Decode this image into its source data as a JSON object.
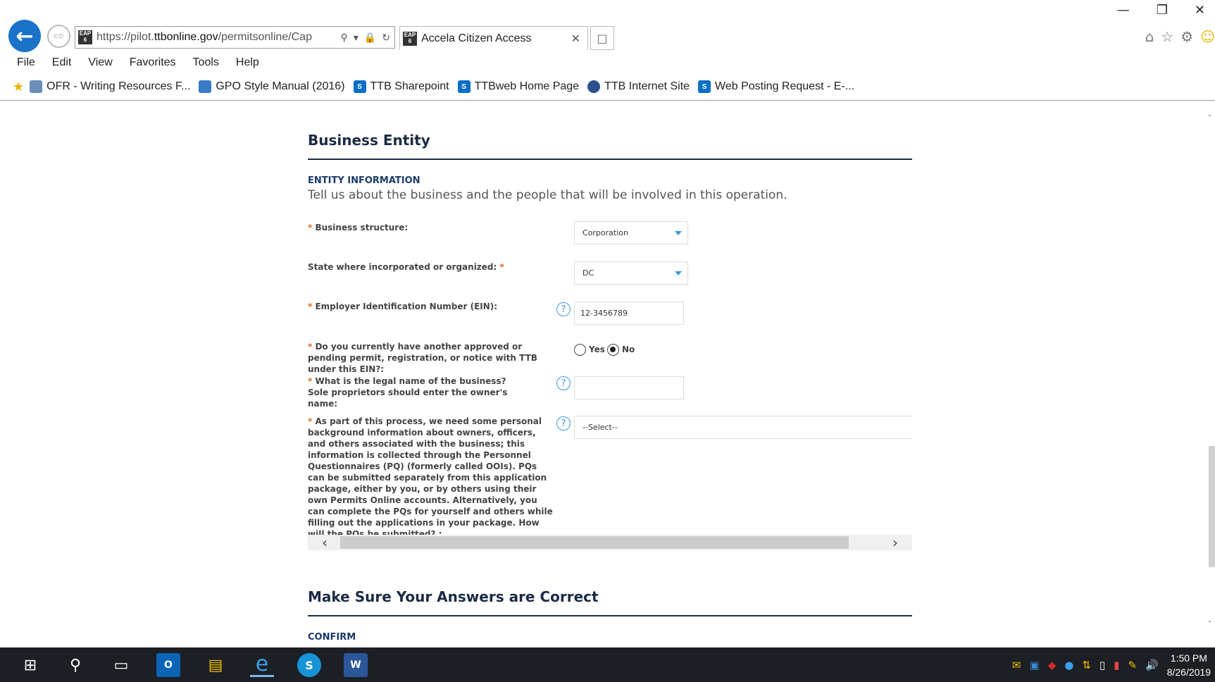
{
  "browser": {
    "url_prefix": "https://pilot.",
    "url_domain": "ttbonline.gov",
    "url_path": "/permitsonline/Cap",
    "favicon_text": "EAP 6",
    "tab_title": "Accela Citizen Access",
    "menu": [
      "File",
      "Edit",
      "View",
      "Favorites",
      "Tools",
      "Help"
    ],
    "favorites": [
      {
        "label": "OFR - Writing Resources F...",
        "icon": "page-icon",
        "color": "#6b8fb8"
      },
      {
        "label": "GPO Style Manual (2016)",
        "icon": "gpo-icon",
        "color": "#3a7bc8"
      },
      {
        "label": "TTB Sharepoint",
        "icon": "sharepoint-icon",
        "color": "#0b6fc4"
      },
      {
        "label": "TTBweb Home Page",
        "icon": "sharepoint-icon",
        "color": "#0b6fc4"
      },
      {
        "label": "TTB Internet Site",
        "icon": "ttb-seal-icon",
        "color": "#2a4f8c"
      },
      {
        "label": "Web Posting Request - E-...",
        "icon": "sharepoint-icon",
        "color": "#0b6fc4"
      }
    ]
  },
  "form": {
    "section_title": "Business Entity",
    "sub_heading": "ENTITY INFORMATION",
    "description": "Tell us about the business and the people that will be involved in this operation.",
    "fields": {
      "business_structure": {
        "label": "Business structure:",
        "value": "Corporation"
      },
      "state": {
        "label": "State where incorporated or organized:",
        "value": "DC"
      },
      "ein": {
        "label": "Employer Identification Number (EIN):",
        "value": "12-3456789"
      },
      "approved_permit": {
        "label": "Do you currently have another approved or pending permit, registration, or notice with TTB under this EIN?:",
        "yes": "Yes",
        "no": "No",
        "selected": "No"
      },
      "legal_name": {
        "label": "What is the legal name of the business? Sole proprietors should enter the owner's name:",
        "value": ""
      },
      "pq_submission": {
        "label": "As part of this process, we need some personal background information about owners, officers, and others associated with the business; this information is collected through the Personnel Questionnaires (PQ) (formerly called OOIs). PQs can be submitted separately from this application package, either by you, or by others using their own Permits Online accounts. Alternatively, you can complete the PQs for yourself and others while filling out the applications in your package. How will the PQs be submitted? :",
        "value": "--Select--"
      }
    },
    "required_mark": "*",
    "help_glyph": "?"
  },
  "confirm": {
    "section_title": "Make Sure Your Answers are Correct",
    "sub_heading": "CONFIRM"
  },
  "taskbar": {
    "time": "1:50 PM",
    "date": "8/26/2019"
  },
  "colors": {
    "accent": "#1b2b44",
    "required": "#e06b1c",
    "help": "#3a9ad9",
    "back_button": "#1a73c9"
  }
}
